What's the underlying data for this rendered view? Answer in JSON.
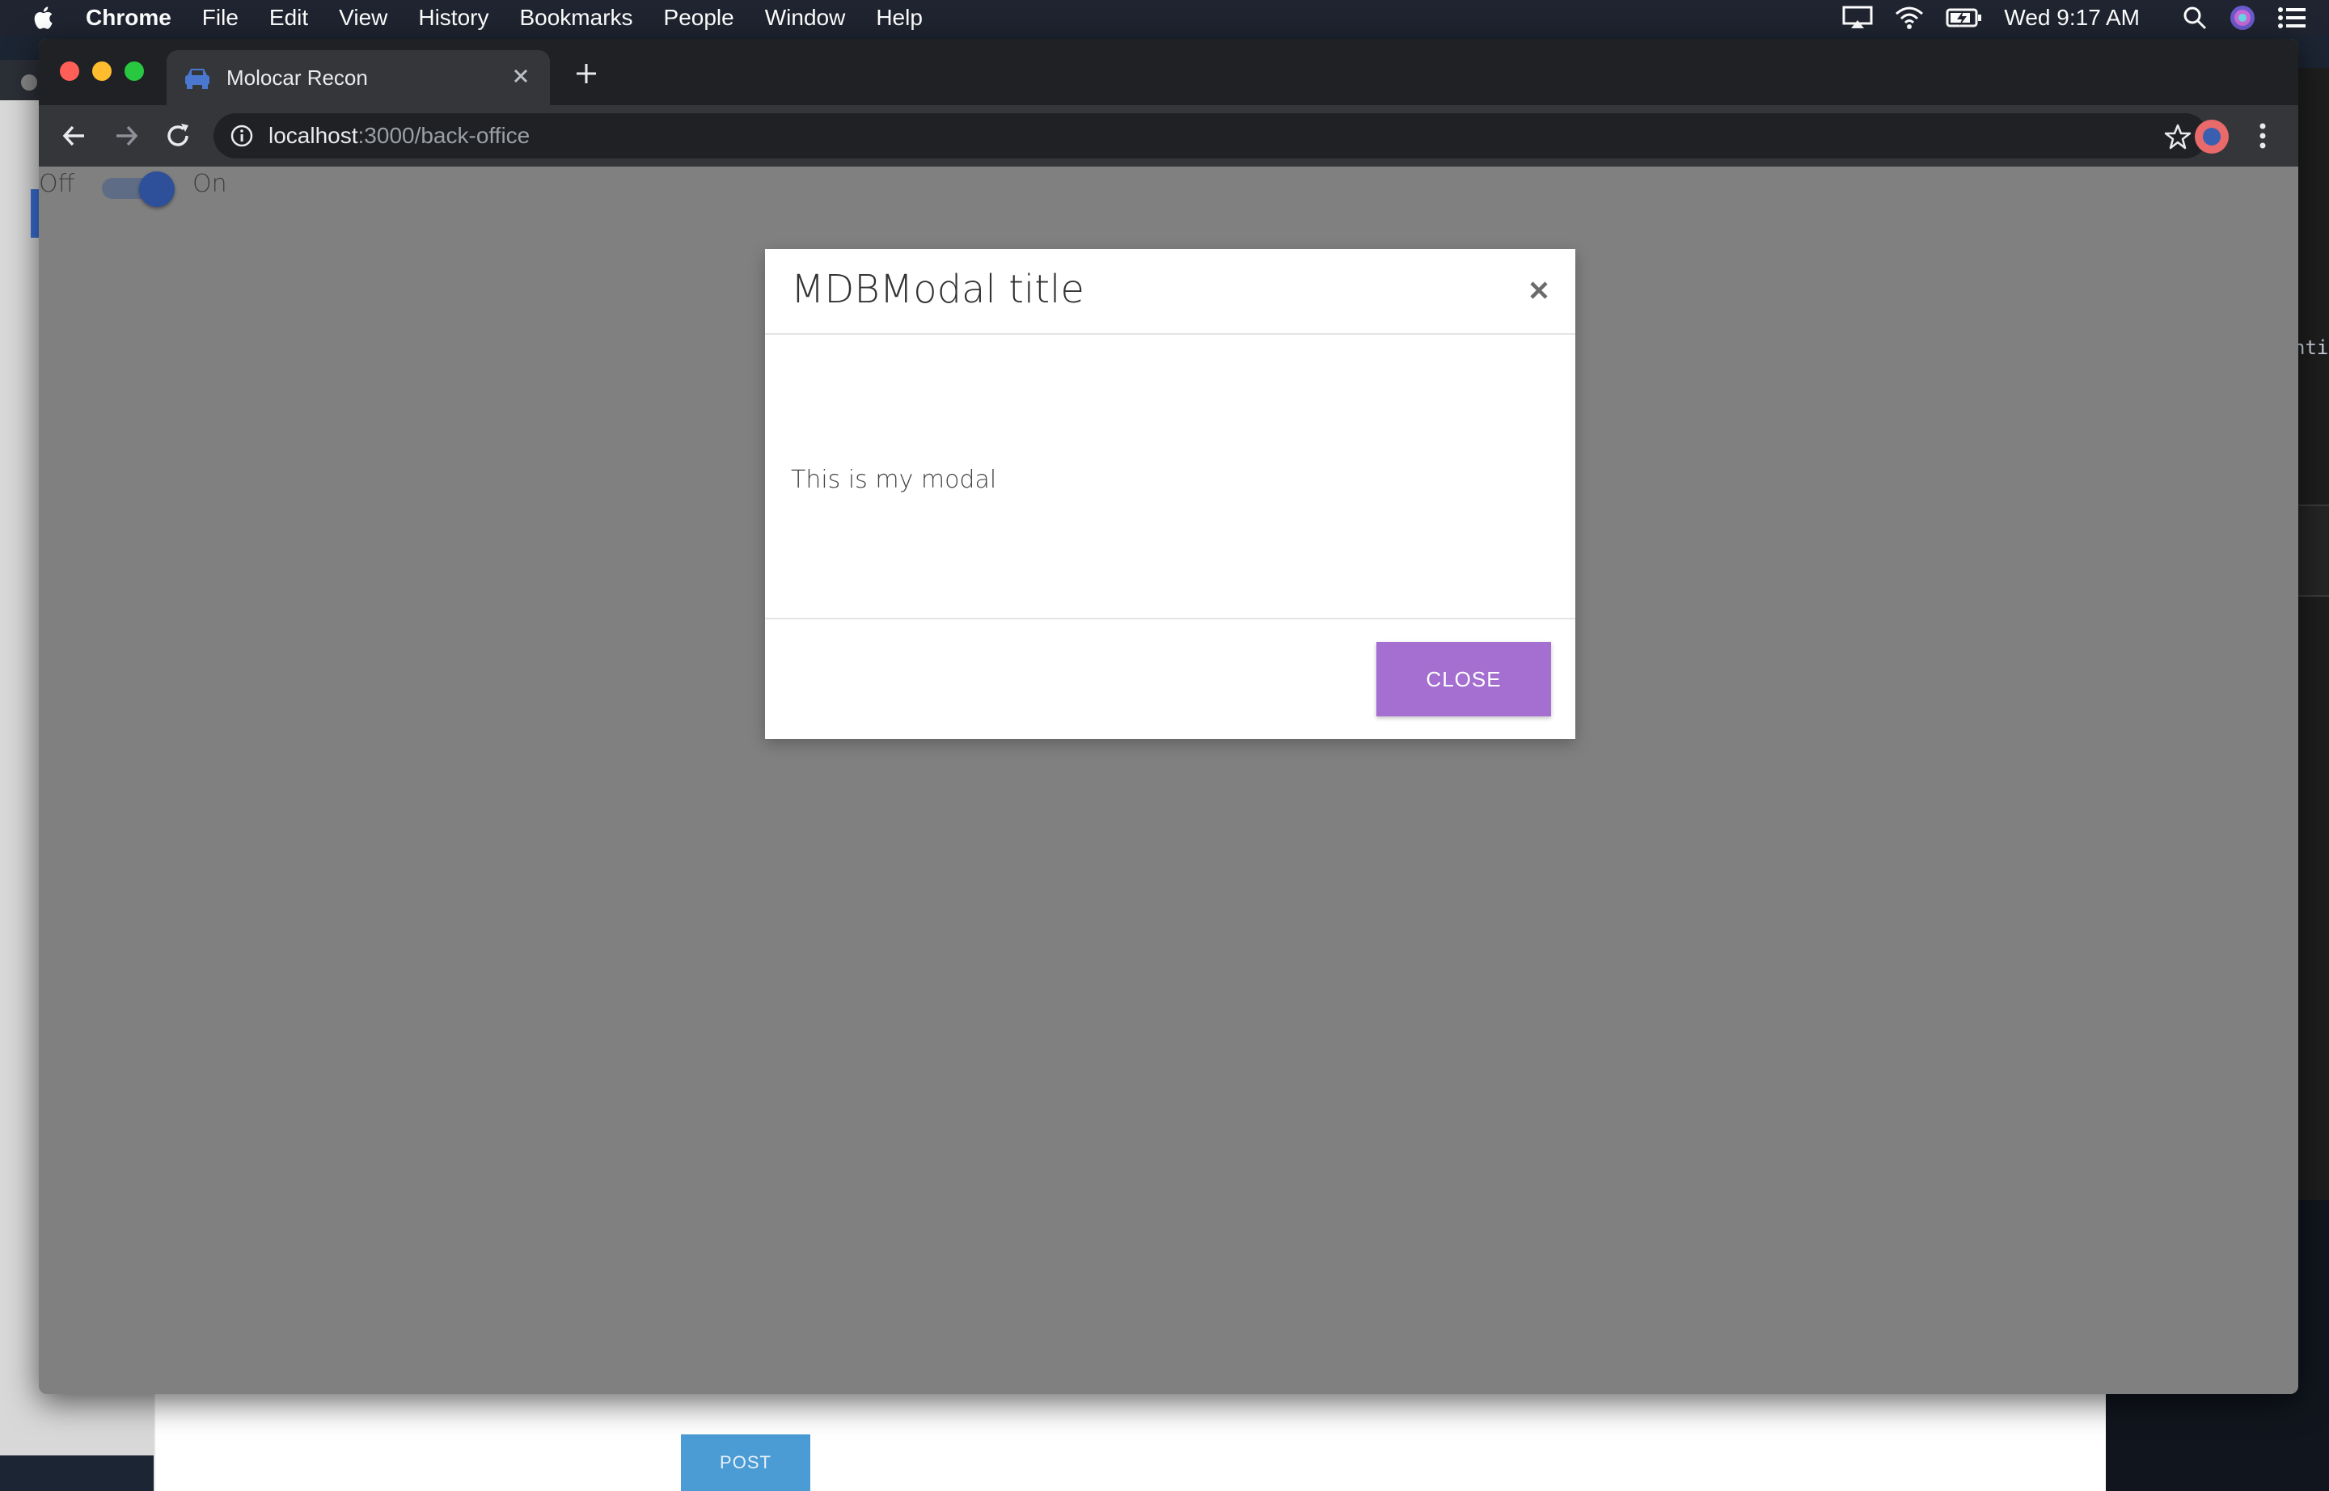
{
  "menubar": {
    "app_name": "Chrome",
    "items": [
      "File",
      "Edit",
      "View",
      "History",
      "Bookmarks",
      "People",
      "Window",
      "Help"
    ],
    "clock": "Wed 9:17 AM",
    "status_icons": [
      "airplay-icon",
      "wifi-icon",
      "battery-icon",
      "spotlight-icon",
      "siri-icon",
      "notification-center-icon"
    ]
  },
  "browser": {
    "tab_title": "Molocar Recon",
    "url_host": "localhost",
    "url_rest": ":3000/back-office"
  },
  "page": {
    "toggle": {
      "off_label": "Off",
      "on_label": "On",
      "state": "on"
    }
  },
  "modal": {
    "title": "MDBModal title",
    "body": "This is my modal",
    "close_button": "CLOSE",
    "close_button_color": "#a46fd0"
  },
  "background": {
    "post_button": "POST",
    "terminal_fragment": "nti"
  }
}
